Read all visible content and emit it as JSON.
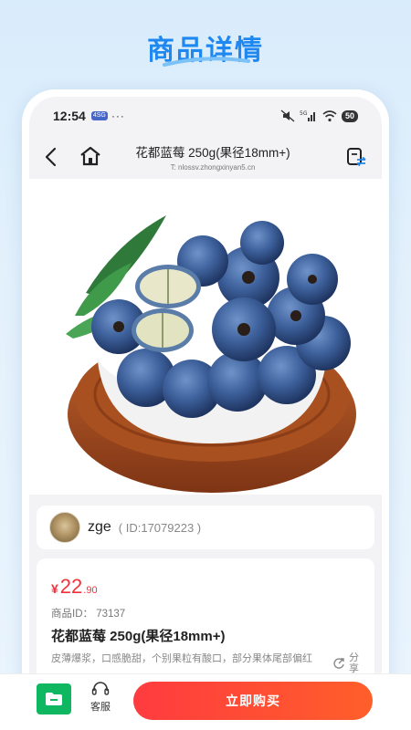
{
  "page_heading": "商品详情",
  "status_bar": {
    "time": "12:54",
    "badge": "4SG",
    "dots": "···",
    "network": "5G",
    "battery": "50"
  },
  "nav": {
    "title": "花都蓝莓 250g(果径18mm+)",
    "subtitle": "T: nlossv.zhongxinyan5.cn"
  },
  "seller": {
    "name": "zge",
    "id_text": "( ID:17079223 )"
  },
  "product": {
    "price_symbol": "¥",
    "price_integer": "22",
    "price_decimal": ".90",
    "goods_id": "商品ID： 73137",
    "title": "花都蓝莓 250g(果径18mm+)",
    "description": "皮薄爆浆，口感脆甜，个别果粒有酸口，部分果体尾部偏红",
    "share_label": "分享"
  },
  "bottom": {
    "service_label": "客服",
    "buy_label": "立即购买"
  },
  "colors": {
    "heading": "#1e88f0",
    "price": "#f2313c",
    "buy_button": "#ff3b3f",
    "folder_button": "#10b761"
  }
}
